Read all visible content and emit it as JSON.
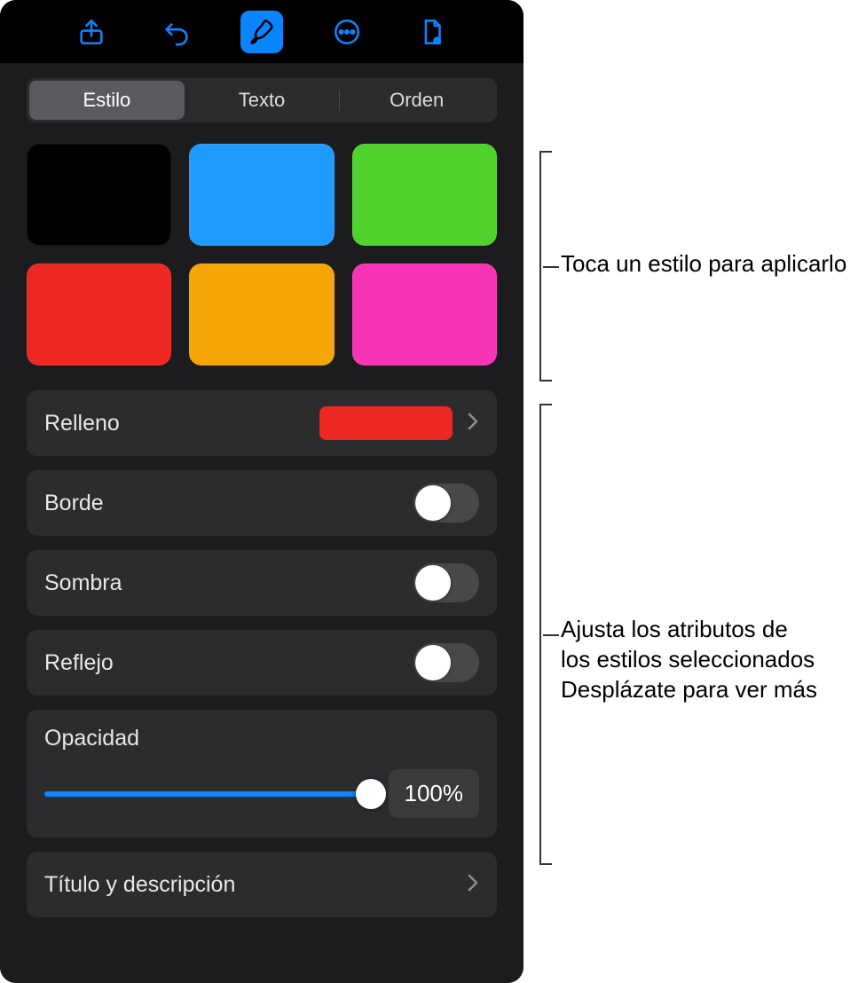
{
  "toolbar": {
    "icons": [
      "share-icon",
      "undo-icon",
      "format-brush-icon",
      "more-icon",
      "document-options-icon"
    ],
    "active_index": 2
  },
  "tabs": {
    "items": [
      "Estilo",
      "Texto",
      "Orden"
    ],
    "selected_index": 0
  },
  "style_swatches": [
    {
      "name": "black",
      "color": "#000000"
    },
    {
      "name": "blue",
      "color": "#1f9bff"
    },
    {
      "name": "green",
      "color": "#4fd22c"
    },
    {
      "name": "red",
      "color": "#ed2722"
    },
    {
      "name": "orange",
      "color": "#f5a506"
    },
    {
      "name": "magenta",
      "color": "#f733b6"
    }
  ],
  "rows": {
    "fill": {
      "label": "Relleno",
      "color": "#ed2722"
    },
    "border": {
      "label": "Borde",
      "on": false
    },
    "shadow": {
      "label": "Sombra",
      "on": false
    },
    "reflect": {
      "label": "Reflejo",
      "on": false
    },
    "opacity": {
      "label": "Opacidad",
      "value_text": "100%",
      "percent": 100
    },
    "title_desc": {
      "label": "Título y descripción"
    }
  },
  "callouts": {
    "styles": "Toca un estilo para aplicarlo",
    "attributes_line1": "Ajusta los atributos de",
    "attributes_line2": "los estilos seleccionados",
    "attributes_line3": "Desplázate para ver más"
  }
}
